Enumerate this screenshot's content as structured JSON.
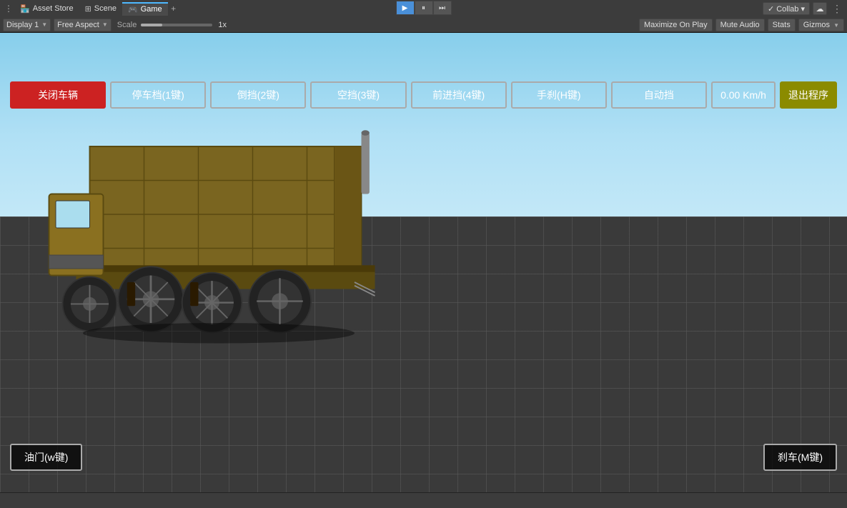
{
  "header": {
    "row1": {
      "menu_items": [
        {
          "id": "asset-store",
          "label": "Asset Store",
          "icon": "🏪",
          "active": false
        },
        {
          "id": "scene",
          "label": "Scene",
          "icon": "⊞",
          "active": false
        },
        {
          "id": "game",
          "label": "Game",
          "icon": "🎮",
          "active": true
        }
      ],
      "dots_label": "⋯",
      "play_icon": "▶",
      "pause_icon": "⏸",
      "step_icon": "⏭",
      "collab_label": "✓ Collab ▾",
      "cloud_icon": "☁"
    },
    "row2": {
      "display_label": "Display 1",
      "aspect_label": "Free Aspect",
      "scale_label": "Scale",
      "scale_value": "1x",
      "maximize_label": "Maximize On Play",
      "mute_label": "Mute Audio",
      "stats_label": "Stats",
      "gizmos_label": "Gizmos"
    }
  },
  "game_buttons": {
    "btn1_label": "关闭车辆",
    "btn2_label": "停车档(1键)",
    "btn3_label": "倒挡(2键)",
    "btn4_label": "空挡(3键)",
    "btn5_label": "前进挡(4键)",
    "btn6_label": "手刹(H键)",
    "btn7_label": "自动挡",
    "speed_label": "0.00 Km/h",
    "exit_label": "退出程序"
  },
  "bottom_buttons": {
    "accelerate_label": "油门(w键)",
    "brake_label": "刹车(M键)"
  },
  "status_bar": {
    "text": ""
  }
}
